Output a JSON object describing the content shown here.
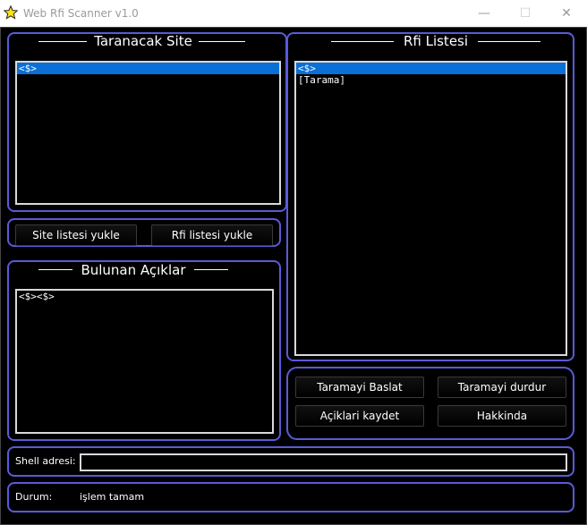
{
  "window": {
    "title": "Web Rfi Scanner v1.0",
    "icon": "star-icon",
    "minimize": "—",
    "maximize": "☐",
    "close": "✕"
  },
  "site_panel": {
    "heading": "Taranacak Site",
    "items": [
      "<$>"
    ],
    "selected_index": 0
  },
  "rfi_panel": {
    "heading": "Rfi Listesi",
    "items": [
      "<$>",
      "[Tarama]"
    ],
    "selected_index": 0
  },
  "load_buttons": {
    "load_sites": "Site listesi yukle",
    "load_rfi": "Rfi listesi yukle"
  },
  "found_panel": {
    "heading": "Bulunan Açıklar",
    "items": [
      "<$><$>"
    ]
  },
  "actions": {
    "start": "Taramayi Baslat",
    "stop": "Taramayi durdur",
    "save": "Açiklari kaydet",
    "about": "Hakkinda"
  },
  "shell": {
    "label": "Shell adresi:",
    "value": ""
  },
  "status": {
    "label": "Durum:",
    "value": "işlem tamam"
  },
  "colors": {
    "panel_border": "#5a5ad8",
    "selection": "#0a6fd6",
    "background": "#000000"
  }
}
